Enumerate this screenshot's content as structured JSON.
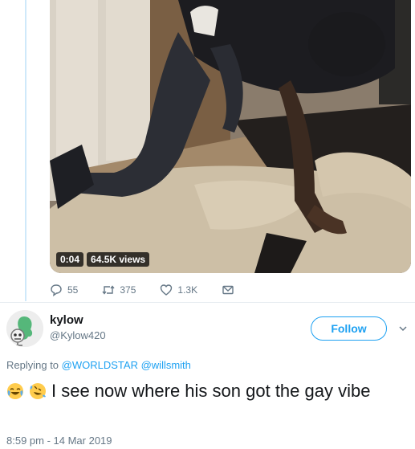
{
  "video": {
    "elapsed": "0:04",
    "views": "64.5K views"
  },
  "tweet_actions": {
    "replies": "55",
    "retweets": "375",
    "likes": "1.3K"
  },
  "reply": {
    "display_name": "kylow",
    "handle": "@Kylow420",
    "follow_label": "Follow",
    "replying_prefix": "Replying to",
    "mention_1": "@WORLDSTAR",
    "mention_2": "@willsmith",
    "text": "I see now where his son got the gay vibe",
    "timestamp": "8:59 pm - 14 Mar 2019"
  },
  "colors": {
    "accent": "#1da1f2",
    "muted": "#657786",
    "thread_line": "#cfe9fa"
  },
  "icons": [
    "reply-icon",
    "retweet-icon",
    "like-icon",
    "dm-icon",
    "chevron-down-icon",
    "joy-emoji-icon",
    "rofl-emoji-icon"
  ]
}
